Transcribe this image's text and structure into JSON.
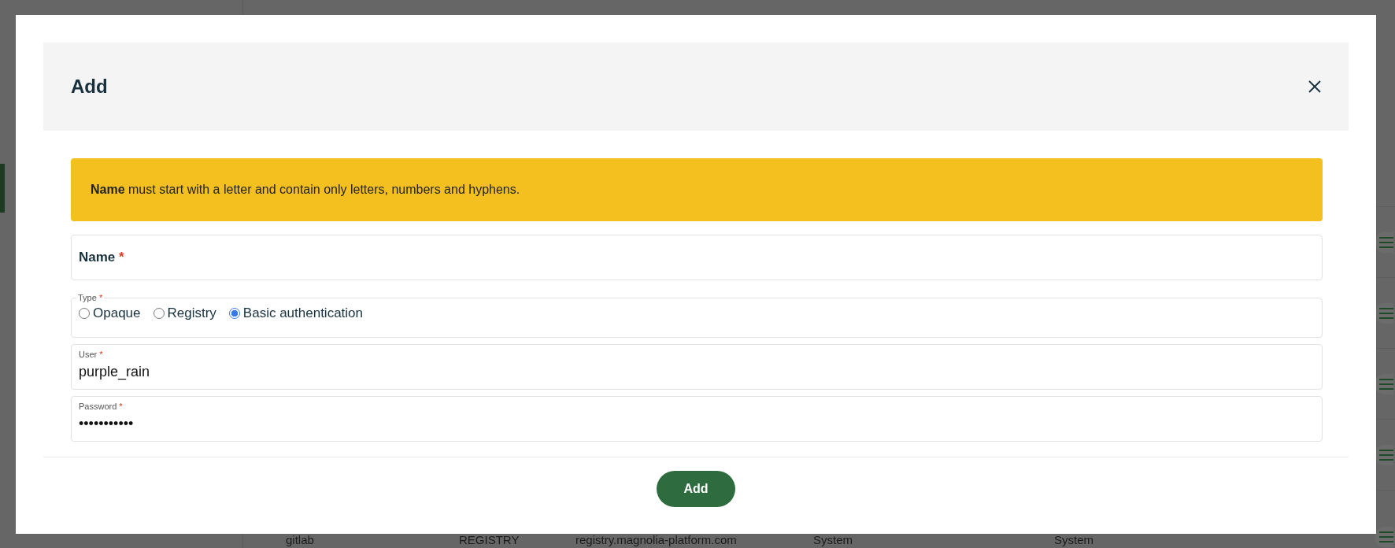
{
  "background": {
    "rows": [
      {
        "cells": [
          "gitlab",
          "REGISTRY",
          "registry.magnolia-platform.com",
          "System",
          "System"
        ]
      }
    ]
  },
  "dialog": {
    "title": "Add",
    "required_mark": "*",
    "banner": "**Name** must start with a letter and contain only letters, numbers and hyphens.",
    "fields": [
      {
        "kind": "text",
        "label": "Name",
        "required": true
      },
      {
        "kind": "radio",
        "label": "Type",
        "required": true,
        "options": [
          {
            "label": "Opaque",
            "selected": false
          },
          {
            "label": "Registry",
            "selected": false
          },
          {
            "label": "Basic authentication",
            "selected": true
          }
        ]
      },
      {
        "kind": "text",
        "label": "User",
        "required": true,
        "value": "purple_rain"
      },
      {
        "kind": "password",
        "label": "Password",
        "required": true,
        "value": "•••••••••••"
      }
    ],
    "button": "Add"
  }
}
